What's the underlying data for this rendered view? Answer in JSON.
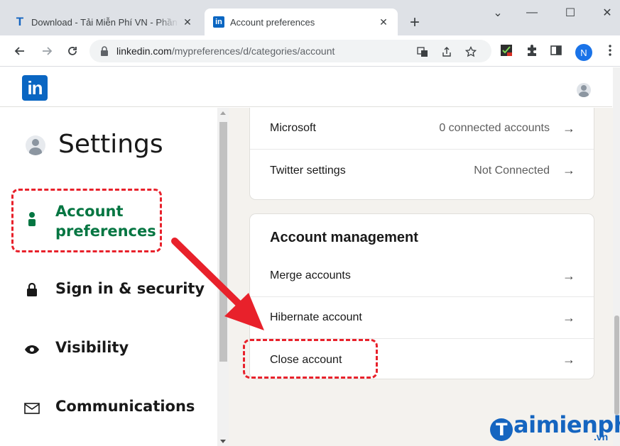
{
  "browser": {
    "tabs": [
      {
        "title": "Download - Tải Miễn Phí VN - Phần mềm",
        "favicon": "taimienphi-t-icon",
        "active": false
      },
      {
        "title": "Account preferences",
        "favicon": "linkedin-icon",
        "active": true
      }
    ],
    "favicon_t": "T",
    "favicon_in": "in",
    "close_glyph": "✕",
    "new_tab_glyph": "+",
    "window_controls": {
      "collapse": "⌄",
      "minimize": "—",
      "maximize": "☐",
      "close": "✕"
    },
    "url_host": "linkedin.com",
    "url_path": "/mypreferences/d/categories/account",
    "profile_initial": "N"
  },
  "linkedin": {
    "logo_text": "in",
    "sidebar": {
      "title": "Settings",
      "items": [
        {
          "label": "Account preferences",
          "icon": "person-icon",
          "active": true
        },
        {
          "label": "Sign in & security",
          "icon": "lock-icon",
          "active": false
        },
        {
          "label": "Visibility",
          "icon": "eye-icon",
          "active": false
        },
        {
          "label": "Communications",
          "icon": "envelope-icon",
          "active": false
        }
      ]
    },
    "connected_accounts": [
      {
        "label": "Microsoft",
        "value": "0 connected accounts"
      },
      {
        "label": "Twitter settings",
        "value": "Not Connected"
      }
    ],
    "account_management": {
      "title": "Account management",
      "items": [
        {
          "label": "Merge accounts"
        },
        {
          "label": "Hibernate account"
        },
        {
          "label": "Close account"
        }
      ]
    },
    "arrow_glyph": "→"
  },
  "watermark": {
    "letter": "T",
    "text": "aimienphi",
    "suffix": ".vn"
  },
  "colors": {
    "linkedin_blue": "#0a66c2",
    "active_green": "#057642",
    "annotation_red": "#e8212b",
    "watermark_blue": "#1565c0"
  }
}
